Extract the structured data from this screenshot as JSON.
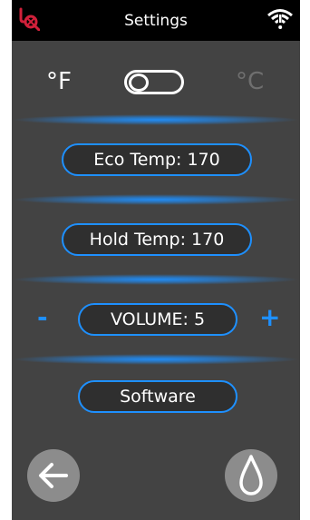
{
  "header": {
    "title": "Settings",
    "logo_icon": "brand-logo-icon",
    "status_icon": "wifi-alert-icon"
  },
  "units": {
    "fahrenheit": "°F",
    "celsius": "°C",
    "selected": "fahrenheit"
  },
  "settings": {
    "eco_temp": "Eco Temp: 170",
    "hold_temp": "Hold Temp: 170",
    "volume": "VOLUME: 5",
    "volume_decrease": "-",
    "volume_increase": "+",
    "software": "Software"
  },
  "footer": {
    "back_icon": "arrow-left-icon",
    "flame_icon": "flame-icon"
  },
  "colors": {
    "accent": "#1e90ff",
    "background": "#434343",
    "topbar": "#000000",
    "logo": "#d0203a",
    "disabled_text": "#6f6f6f",
    "round_button": "#8c8c8c"
  }
}
